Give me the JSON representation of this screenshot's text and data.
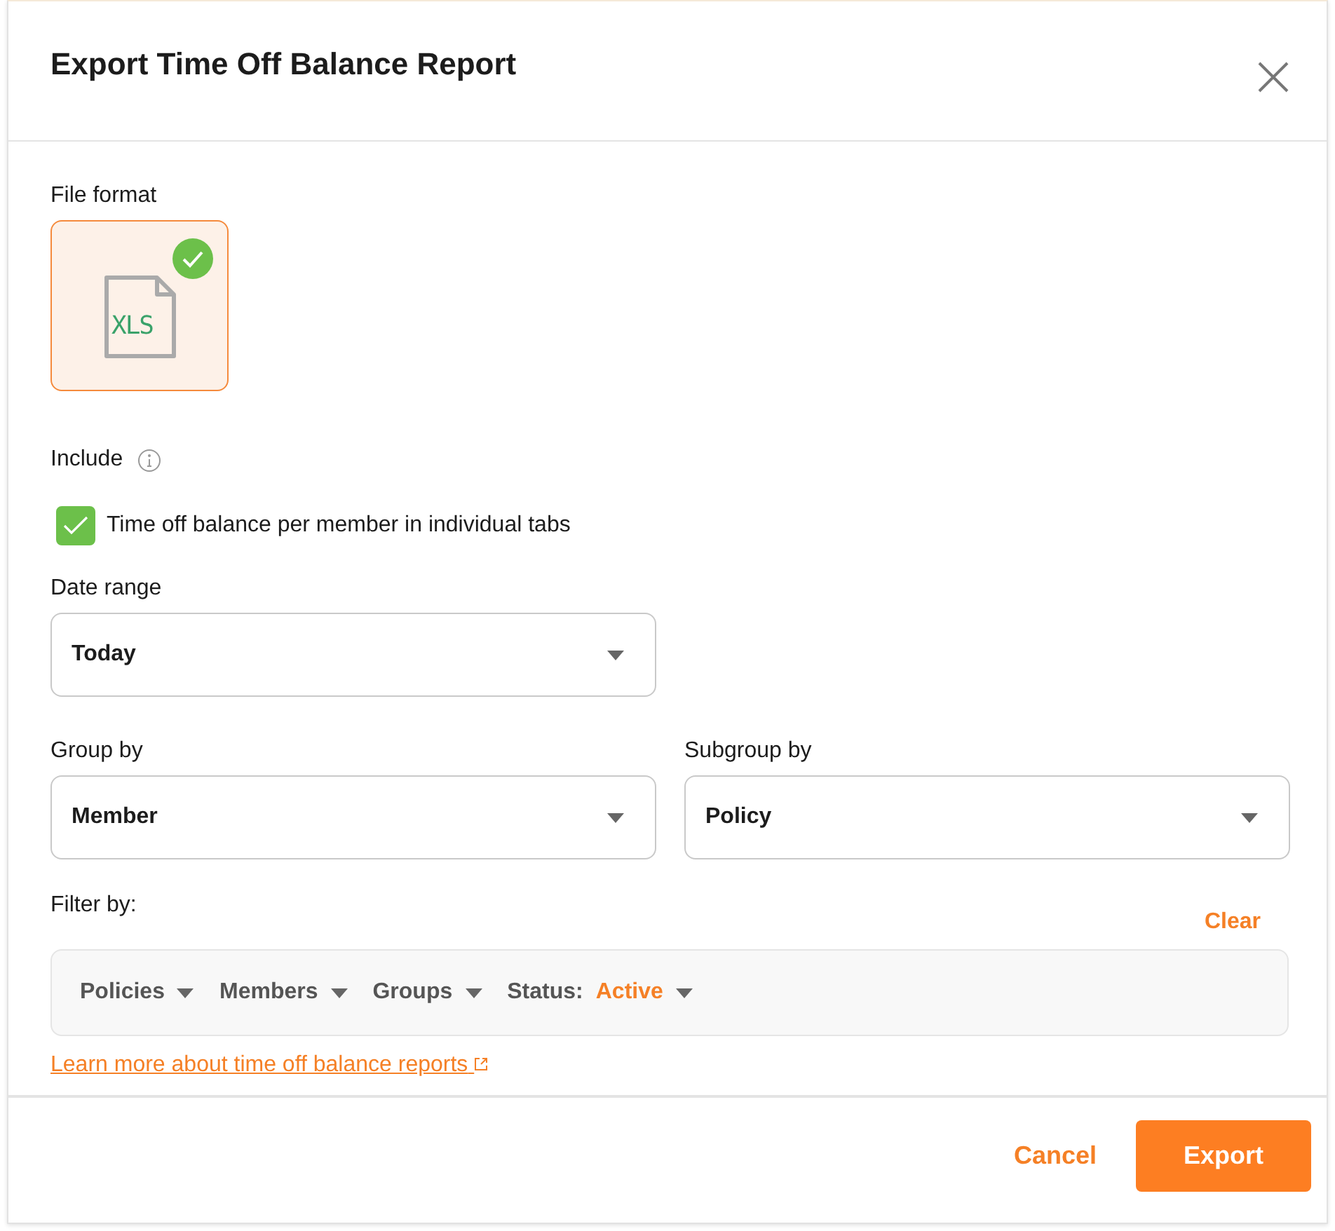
{
  "dialog": {
    "title": "Export Time Off Balance Report"
  },
  "file_format": {
    "label": "File format",
    "options": [
      {
        "text": "XLS",
        "selected": true
      }
    ]
  },
  "include": {
    "label": "Include",
    "options": [
      {
        "label": "Time off balance per member in individual tabs",
        "checked": true
      }
    ]
  },
  "date_range": {
    "label": "Date range",
    "value": "Today"
  },
  "group_by": {
    "label": "Group by",
    "value": "Member"
  },
  "subgroup_by": {
    "label": "Subgroup by",
    "value": "Policy"
  },
  "filter": {
    "label": "Filter by:",
    "clear": "Clear",
    "filters": [
      {
        "label": "Policies"
      },
      {
        "label": "Members"
      },
      {
        "label": "Groups"
      },
      {
        "label": "Status",
        "separator": ":",
        "value": "Active"
      }
    ]
  },
  "learn_more": "Learn more about time off balance reports",
  "buttons": {
    "cancel": "Cancel",
    "export": "Export"
  }
}
